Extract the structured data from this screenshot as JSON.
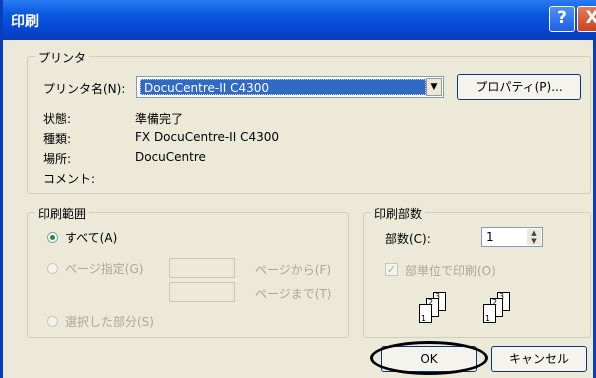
{
  "window": {
    "title": "印刷",
    "help_label": "?",
    "close_label": "X"
  },
  "printer": {
    "legend": "プリンタ",
    "name_label": "プリンタ名(N):",
    "name_value": "DocuCentre-II C4300",
    "dropdown_arrow": "▼",
    "properties_button": "プロパティ(P)...",
    "status_label": "状態:",
    "status_value": "準備完了",
    "type_label": "種類:",
    "type_value": "FX DocuCentre-II C4300",
    "location_label": "場所:",
    "location_value": "DocuCentre",
    "comment_label": "コメント:"
  },
  "range": {
    "legend": "印刷範囲",
    "all_label": "すべて(A)",
    "pages_label": "ページ指定(G)",
    "from_label": "ページから(F)",
    "to_label": "ページまで(T)",
    "selection_label": "選択した部分(S)"
  },
  "copies": {
    "legend": "印刷部数",
    "count_label": "部数(C):",
    "count_value": "1",
    "collate_label": "部単位で印刷(O)",
    "collate_checked": true
  },
  "buttons": {
    "ok": "OK",
    "cancel": "キャンセル"
  }
}
